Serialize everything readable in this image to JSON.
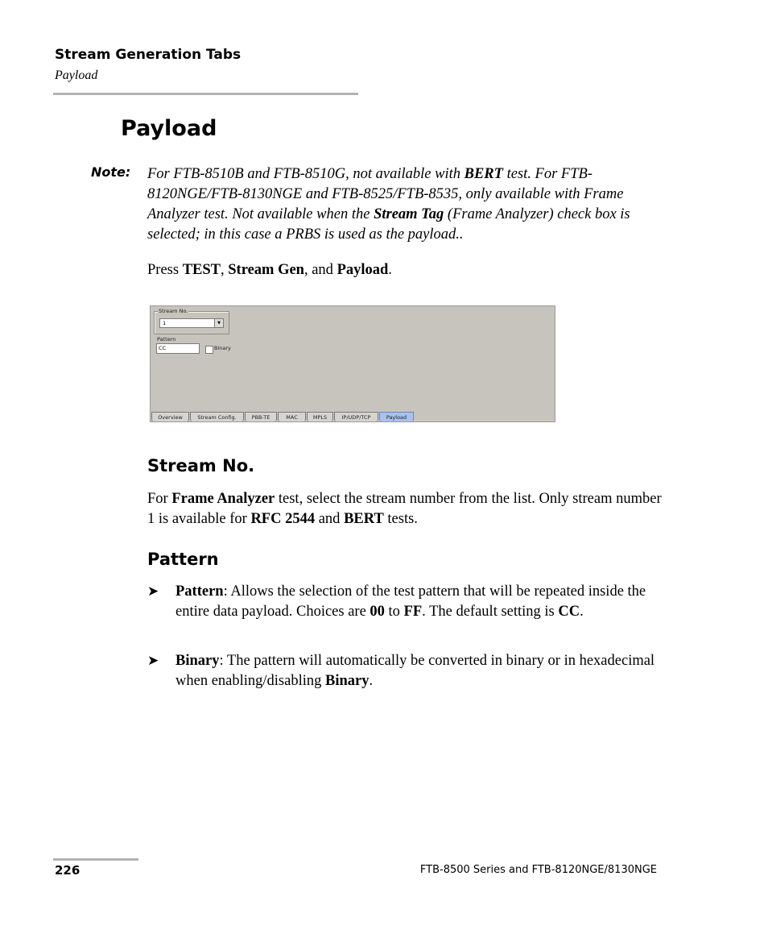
{
  "header": {
    "section": "Stream Generation Tabs",
    "subsection": "Payload"
  },
  "page_title": "Payload",
  "note": {
    "label": "Note:",
    "segments": [
      {
        "text": "For FTB-8510B and FTB-8510G, not available with ",
        "bold": false
      },
      {
        "text": "BERT",
        "bold": true
      },
      {
        "text": " test. For FTB-8120NGE/FTB-8130NGE and FTB-8525/FTB-8535, only available with Frame Analyzer test. Not available when the ",
        "bold": false
      },
      {
        "text": "Stream Tag",
        "bold": true
      },
      {
        "text": " (Frame Analyzer) check box is selected; in this case a PRBS is used as the payload..",
        "bold": false
      }
    ]
  },
  "press_instruction": {
    "prefix": "Press ",
    "key1": "TEST",
    "sep1": ", ",
    "key2": "Stream Gen",
    "sep2": ", and ",
    "key3": "Payload",
    "suffix": "."
  },
  "screenshot": {
    "stream_group_label": "Stream No.",
    "stream_value": "1",
    "pattern_label": "Pattern",
    "pattern_value": "CC",
    "binary_label": "Binary",
    "binary_checked": false,
    "tabs": [
      {
        "label": "Overview",
        "active": false
      },
      {
        "label": "Stream Config.",
        "active": false
      },
      {
        "label": "PBB-TE",
        "active": false
      },
      {
        "label": "MAC",
        "active": false
      },
      {
        "label": "MPLS",
        "active": false
      },
      {
        "label": "IP/UDP/TCP",
        "active": false
      },
      {
        "label": "Payload",
        "active": true
      }
    ]
  },
  "stream_no": {
    "heading": "Stream No.",
    "segments": [
      {
        "text": "For ",
        "bold": false
      },
      {
        "text": "Frame Analyzer",
        "bold": true
      },
      {
        "text": " test, select the stream number from the list. Only stream number 1 is available for ",
        "bold": false
      },
      {
        "text": "RFC 2544",
        "bold": true
      },
      {
        "text": " and ",
        "bold": false
      },
      {
        "text": "BERT",
        "bold": true
      },
      {
        "text": " tests.",
        "bold": false
      }
    ]
  },
  "pattern": {
    "heading": "Pattern",
    "bullet_marker": "➤",
    "bullets": [
      {
        "segments": [
          {
            "text": "Pattern",
            "bold": true
          },
          {
            "text": ": Allows the selection of the test pattern that will be repeated inside the entire data payload. Choices are ",
            "bold": false
          },
          {
            "text": "00",
            "bold": true
          },
          {
            "text": " to ",
            "bold": false
          },
          {
            "text": "FF",
            "bold": true
          },
          {
            "text": ". The default setting is ",
            "bold": false
          },
          {
            "text": "CC",
            "bold": true
          },
          {
            "text": ".",
            "bold": false
          }
        ]
      },
      {
        "segments": [
          {
            "text": "Binary",
            "bold": true
          },
          {
            "text": ": The pattern will automatically be converted in binary or in hexadecimal when enabling/disabling ",
            "bold": false
          },
          {
            "text": "Binary",
            "bold": true
          },
          {
            "text": ".",
            "bold": false
          }
        ]
      }
    ]
  },
  "footer": {
    "page_number": "226",
    "title": "FTB-8500 Series and FTB-8120NGE/8130NGE"
  }
}
